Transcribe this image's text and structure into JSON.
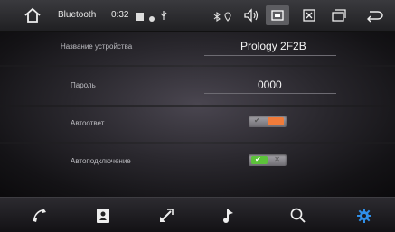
{
  "statusbar": {
    "title": "Bluetooth",
    "time": "0:32",
    "icons": [
      "home-icon",
      "sd-card-icon",
      "dot-icon",
      "usb-icon",
      "bluetooth-icon",
      "location-icon",
      "volume-icon",
      "settings-screen-icon",
      "close-window-icon",
      "windows-icon",
      "back-icon"
    ]
  },
  "settings": {
    "device_name_label": "Название устройства",
    "device_name_value": "Prology 2F2B",
    "password_label": "Пароль",
    "password_value": "0000",
    "autoanswer_label": "Автоответ",
    "autoanswer_on": false,
    "autoconnect_label": "Автоподключение",
    "autoconnect_on": true
  },
  "bottombar": {
    "icons": [
      "phone-icon",
      "contacts-icon",
      "call-transfer-icon",
      "music-icon",
      "search-icon",
      "settings-gear-icon"
    ],
    "active": "settings-gear-icon",
    "active_color": "#2f8fe8"
  }
}
